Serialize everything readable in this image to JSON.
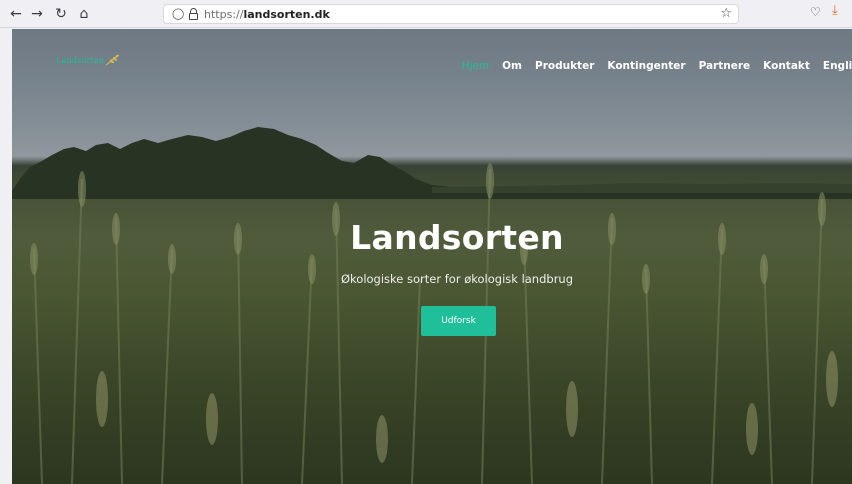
{
  "browser": {
    "url_protocol": "https://",
    "url_host": "landsorten.dk"
  },
  "site": {
    "logo_text": "Landsorten",
    "nav": [
      {
        "label": "Hjem",
        "active": true
      },
      {
        "label": "Om"
      },
      {
        "label": "Produkter"
      },
      {
        "label": "Kontingenter"
      },
      {
        "label": "Partnere"
      },
      {
        "label": "Kontakt"
      },
      {
        "label": "English"
      }
    ],
    "hero": {
      "title": "Landsorten",
      "subtitle": "Økologiske sorter for økologisk landbrug",
      "cta_label": "Udforsk"
    }
  },
  "colors": {
    "accent": "#1fbf9a",
    "hero_text": "#ffffff"
  },
  "icons": {
    "back": "arrow-left-icon",
    "forward": "arrow-right-icon",
    "reload": "reload-icon",
    "home": "home-icon",
    "tracking": "shield-icon",
    "lock": "lock-icon",
    "bookmark": "star-icon",
    "pocket": "pocket-icon",
    "download": "download-icon",
    "logo": "wheat-icon"
  }
}
